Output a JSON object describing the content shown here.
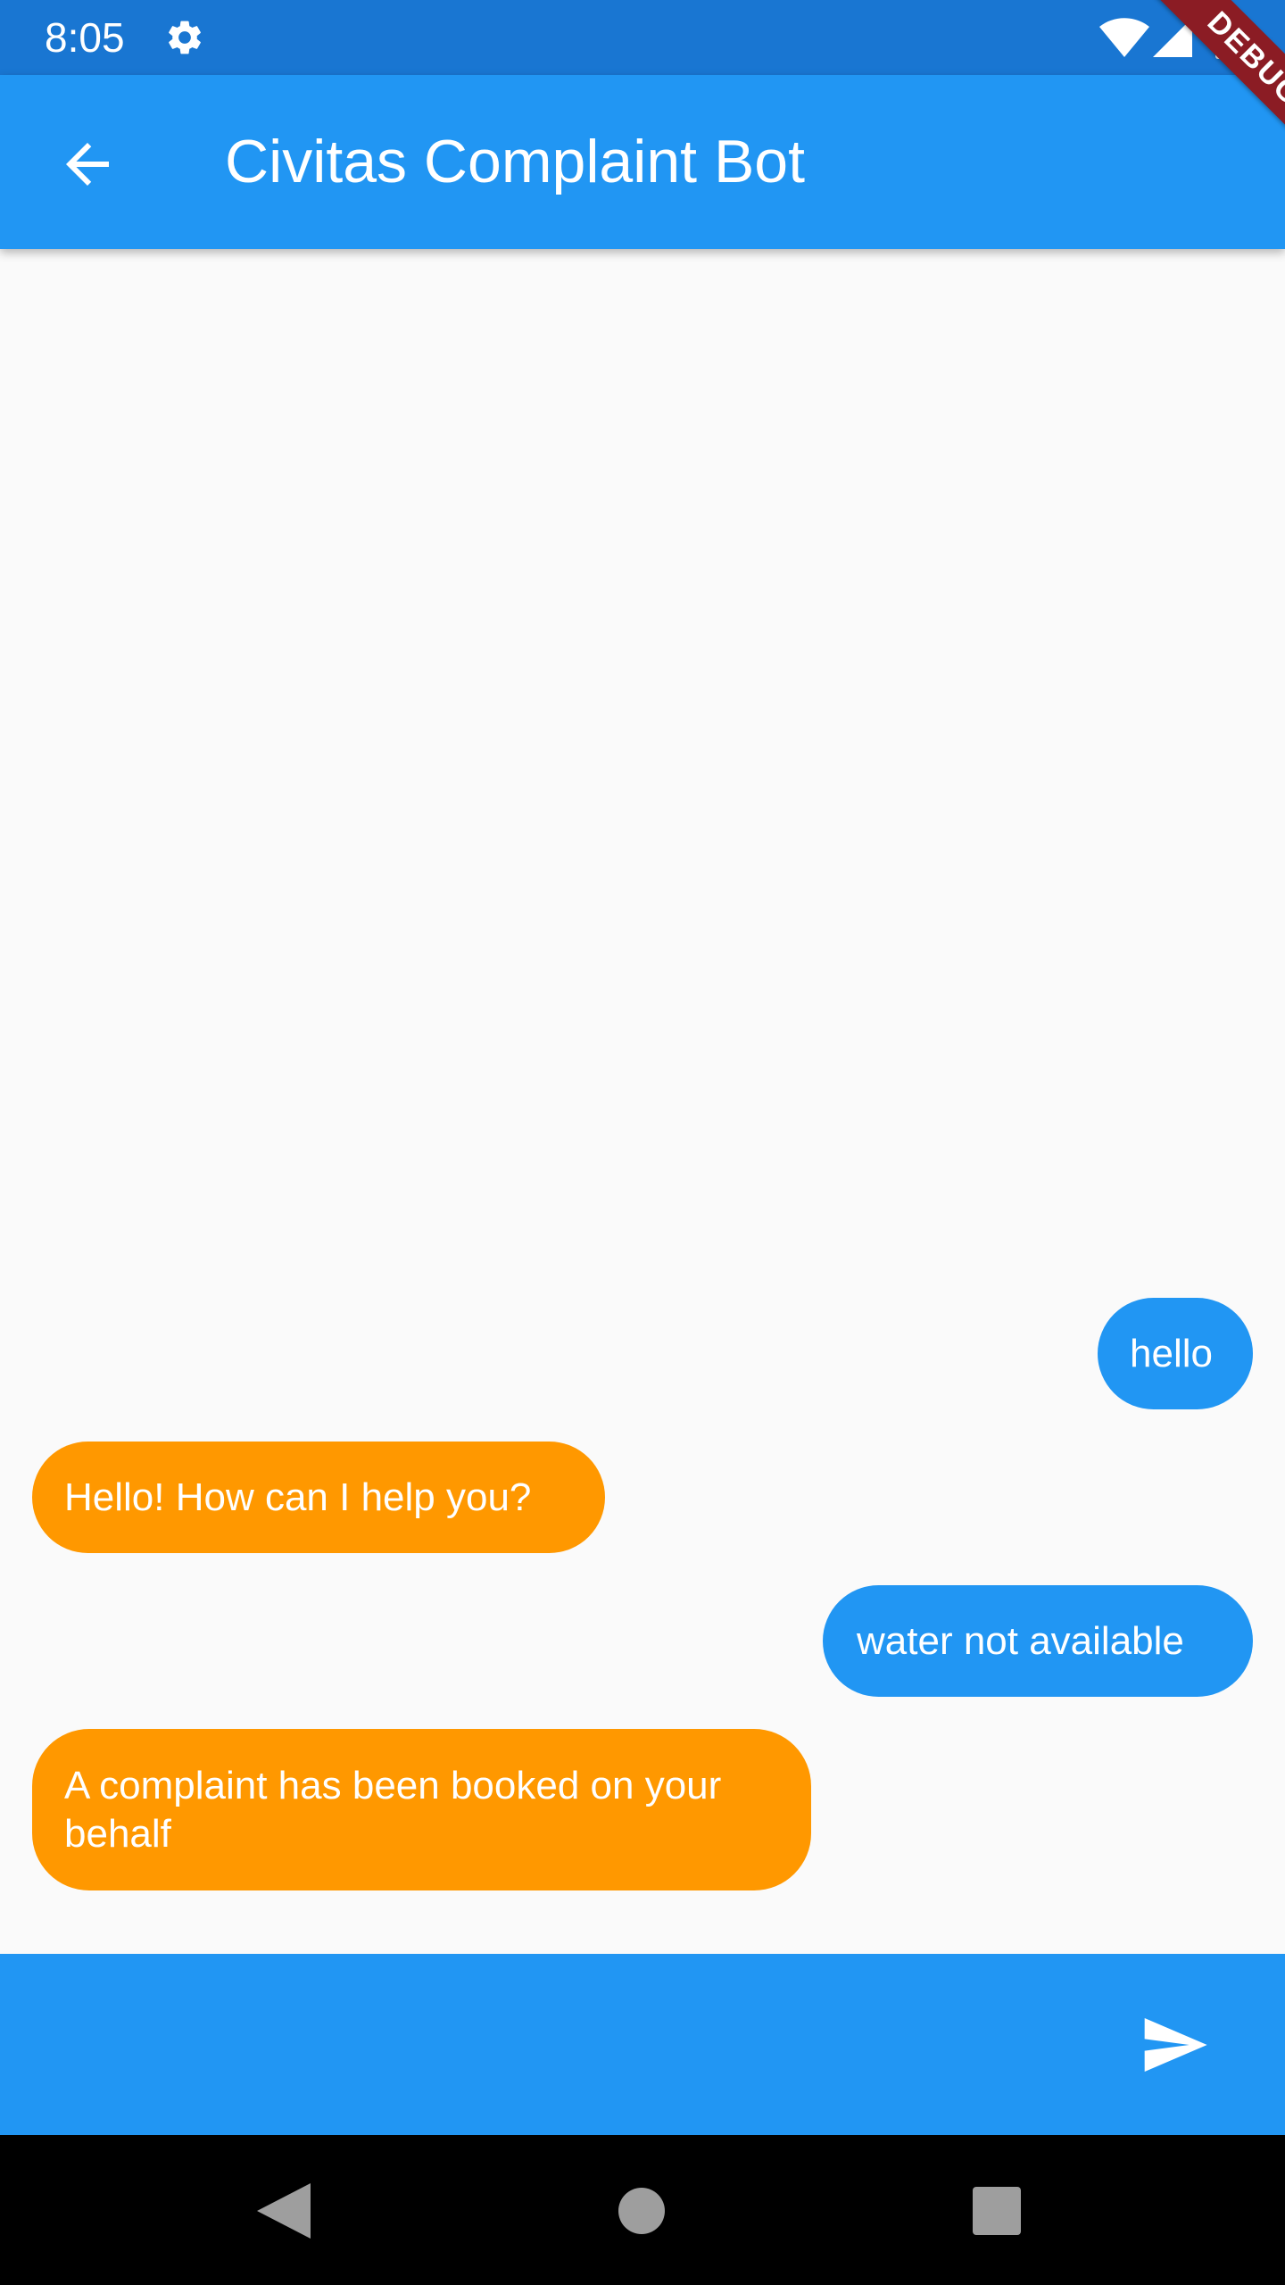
{
  "status_bar": {
    "time": "8:05",
    "icons": [
      "gear-icon",
      "wifi-icon",
      "cell-signal-icon",
      "battery-icon"
    ]
  },
  "app_bar": {
    "title": "Civitas Complaint Bot",
    "back_icon": "arrow-back-icon",
    "color": "#2196f3"
  },
  "debug_banner": {
    "label": "DEBUG",
    "color": "#8b1c24"
  },
  "messages": [
    {
      "sender": "user",
      "text": "hello"
    },
    {
      "sender": "bot",
      "text": "Hello! How can I help you?"
    },
    {
      "sender": "user",
      "text": "water not available"
    },
    {
      "sender": "bot",
      "text": "A complaint has been booked on your behalf"
    }
  ],
  "colors": {
    "user_bubble": "#2196f3",
    "bot_bubble": "#ff9800",
    "status_bar": "#1976d2"
  },
  "composer": {
    "value": "",
    "placeholder": "",
    "send_icon": "send-icon"
  },
  "nav_bar": {
    "icons": [
      "nav-back-icon",
      "nav-home-icon",
      "nav-recents-icon"
    ]
  }
}
